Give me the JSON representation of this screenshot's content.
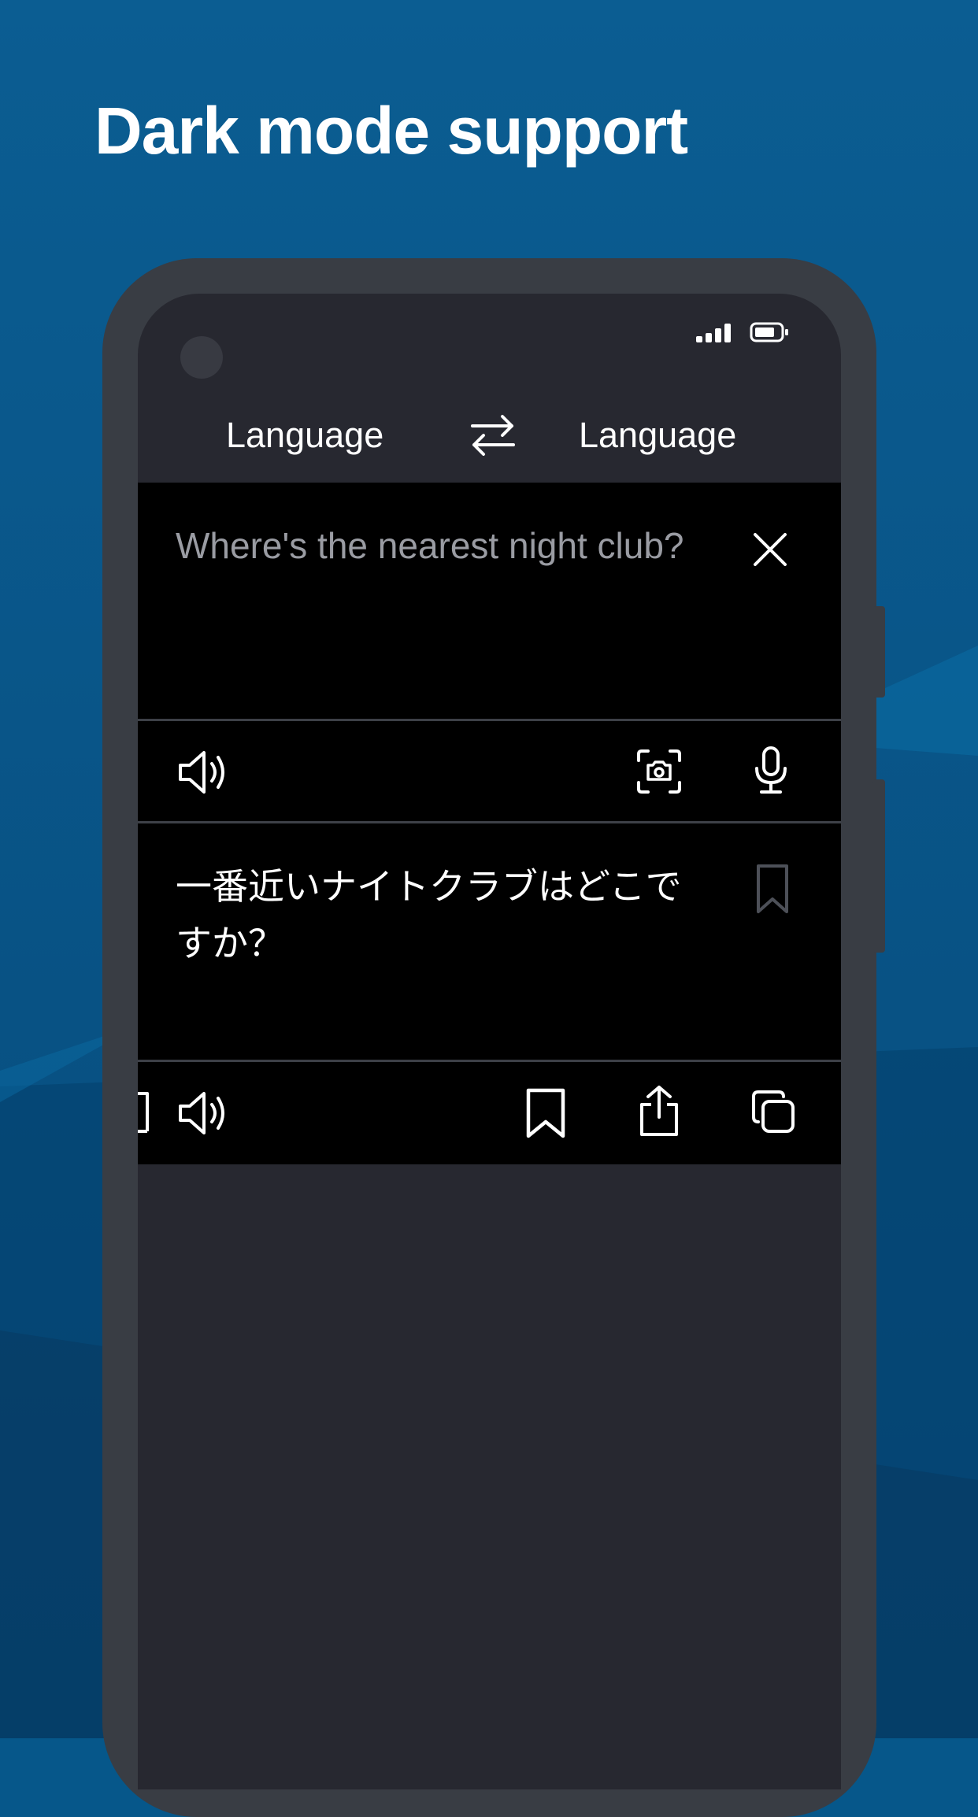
{
  "headline": "Dark mode support",
  "header": {
    "source_language": "Language",
    "target_language": "Language"
  },
  "input": {
    "text": "Where's the nearest night club?"
  },
  "output": {
    "text": "一番近いナイトクラブはどこですか？"
  },
  "icons": {
    "status": [
      "signal-icon",
      "battery-icon"
    ],
    "swap": "swap-arrows-icon",
    "clear": "close-icon",
    "input_toolbar": [
      "speaker-icon",
      "camera-scan-icon",
      "microphone-icon"
    ],
    "output_side": "bookmark-icon",
    "output_toolbar": [
      "bookmark-icon-partial",
      "speaker-icon",
      "bookmark-icon",
      "share-icon",
      "copy-icon"
    ]
  },
  "colors": {
    "background": "#06578a",
    "phone_frame": "#393d44",
    "screen": "#272830",
    "panel": "#000000",
    "text_primary": "#ffffff",
    "text_placeholder": "#9a9ca3"
  }
}
